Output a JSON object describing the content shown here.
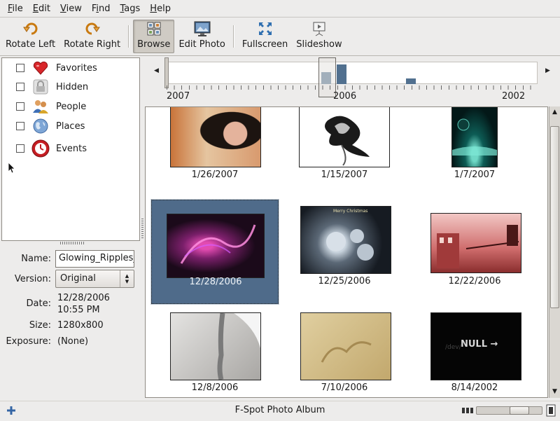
{
  "menubar": {
    "items": [
      {
        "pre": "",
        "ul": "F",
        "post": "ile"
      },
      {
        "pre": "",
        "ul": "E",
        "post": "dit"
      },
      {
        "pre": "",
        "ul": "V",
        "post": "iew"
      },
      {
        "pre": "F",
        "ul": "i",
        "post": "nd"
      },
      {
        "pre": "",
        "ul": "T",
        "post": "ags"
      },
      {
        "pre": "",
        "ul": "H",
        "post": "elp"
      }
    ]
  },
  "toolbar": {
    "rotate_left": "Rotate Left",
    "rotate_right": "Rotate Right",
    "browse": "Browse",
    "edit_photo": "Edit Photo",
    "fullscreen": "Fullscreen",
    "slideshow": "Slideshow",
    "active": "browse"
  },
  "tags": {
    "items": [
      {
        "label": "Favorites",
        "icon": "heart-icon",
        "checked": false
      },
      {
        "label": "Hidden",
        "icon": "lock-icon",
        "checked": false
      },
      {
        "label": "People",
        "icon": "people-icon",
        "checked": false
      },
      {
        "label": "Places",
        "icon": "globe-icon",
        "checked": false
      },
      {
        "label": "Events",
        "icon": "clock-icon",
        "checked": false
      }
    ]
  },
  "info": {
    "name_label": "Name:",
    "name_value": "Glowing_Ripples_",
    "version_label": "Version:",
    "version_value": "Original",
    "date_label": "Date:",
    "date_value": "12/28/2006",
    "time_value": "10:55 PM",
    "size_label": "Size:",
    "size_value": "1280x800",
    "exposure_label": "Exposure:",
    "exposure_value": "(None)"
  },
  "timeline": {
    "years": [
      "2007",
      "2006",
      "2002"
    ]
  },
  "photos": [
    {
      "date": "1/26/2007",
      "selected": false
    },
    {
      "date": "1/15/2007",
      "selected": false
    },
    {
      "date": "1/7/2007",
      "selected": false
    },
    {
      "date": "12/28/2006",
      "selected": true
    },
    {
      "date": "12/25/2006",
      "selected": false
    },
    {
      "date": "12/22/2006",
      "selected": false
    },
    {
      "date": "12/8/2006",
      "selected": false
    },
    {
      "date": "7/10/2006",
      "selected": false
    },
    {
      "date": "8/14/2002",
      "selected": false
    }
  ],
  "thumb_text": {
    "christmas": "Merry Christmas",
    "null_text": "NULL →",
    "null_sub": "/dev/"
  },
  "status": {
    "text": "F-Spot Photo Album",
    "zoom_fraction": 0.72
  },
  "colors": {
    "selection": "#4f6b8a",
    "timeline_bar": "#51708f"
  }
}
